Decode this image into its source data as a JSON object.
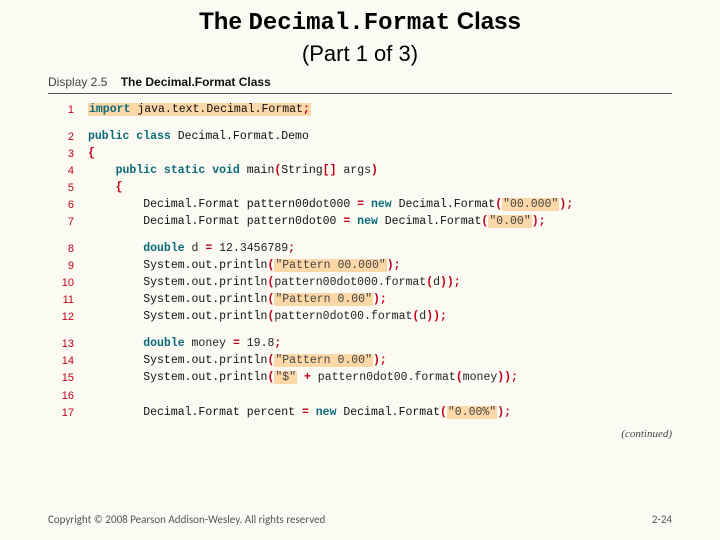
{
  "title_pre": "The ",
  "title_class": "Decimal.Format",
  "title_post": " Class",
  "subtitle": "(Part 1 of 3)",
  "display_label": "Display 2.5",
  "display_caption": "The Decimal.Format Class",
  "lines": [
    {
      "n": "1",
      "indent": 0,
      "tokens": [
        [
          "kw",
          "import "
        ],
        [
          "cls",
          "java.text.Decimal.Format"
        ],
        [
          "op",
          ";"
        ]
      ],
      "hl": true
    },
    {
      "gap": true
    },
    {
      "n": "2",
      "indent": 0,
      "tokens": [
        [
          "kw",
          "public class "
        ],
        [
          "cls",
          "Decimal.Format.Demo"
        ]
      ]
    },
    {
      "n": "3",
      "indent": 0,
      "tokens": [
        [
          "op",
          "{"
        ]
      ]
    },
    {
      "n": "4",
      "indent": 1,
      "tokens": [
        [
          "kw",
          "public static void "
        ],
        [
          "cls",
          "main"
        ],
        [
          "op",
          "("
        ],
        [
          "cls",
          "String"
        ],
        [
          "op",
          "[] "
        ],
        [
          "t",
          "args"
        ],
        [
          "op",
          ")"
        ]
      ]
    },
    {
      "n": "5",
      "indent": 1,
      "tokens": [
        [
          "op",
          "{"
        ]
      ]
    },
    {
      "n": "6",
      "indent": 2,
      "tokens": [
        [
          "cls",
          "Decimal.Format pattern00dot000 "
        ],
        [
          "op",
          "= "
        ],
        [
          "kw",
          "new "
        ],
        [
          "cls",
          "Decimal.Format"
        ],
        [
          "op",
          "("
        ],
        [
          "str",
          "\"00.000\""
        ],
        [
          "op",
          ");"
        ]
      ]
    },
    {
      "n": "7",
      "indent": 2,
      "tokens": [
        [
          "cls",
          "Decimal.Format pattern0dot00 "
        ],
        [
          "op",
          "= "
        ],
        [
          "kw",
          "new "
        ],
        [
          "cls",
          "Decimal.Format"
        ],
        [
          "op",
          "("
        ],
        [
          "str",
          "\"0.00\""
        ],
        [
          "op",
          ");"
        ]
      ]
    },
    {
      "gap": true
    },
    {
      "n": "8",
      "indent": 2,
      "tokens": [
        [
          "kw",
          "double "
        ],
        [
          "t",
          "d "
        ],
        [
          "op",
          "= "
        ],
        [
          "t",
          "12.3456789"
        ],
        [
          "op",
          ";"
        ]
      ]
    },
    {
      "n": "9",
      "indent": 2,
      "tokens": [
        [
          "cls",
          "System.out.println"
        ],
        [
          "op",
          "("
        ],
        [
          "str",
          "\"Pattern 00.000\""
        ],
        [
          "op",
          ");"
        ]
      ]
    },
    {
      "n": "10",
      "indent": 2,
      "tokens": [
        [
          "cls",
          "System.out.println"
        ],
        [
          "op",
          "("
        ],
        [
          "t",
          "pattern00dot000.format"
        ],
        [
          "op",
          "("
        ],
        [
          "t",
          "d"
        ],
        [
          "op",
          "));"
        ]
      ]
    },
    {
      "n": "11",
      "indent": 2,
      "tokens": [
        [
          "cls",
          "System.out.println"
        ],
        [
          "op",
          "("
        ],
        [
          "str",
          "\"Pattern 0.00\""
        ],
        [
          "op",
          ");"
        ]
      ]
    },
    {
      "n": "12",
      "indent": 2,
      "tokens": [
        [
          "cls",
          "System.out.println"
        ],
        [
          "op",
          "("
        ],
        [
          "t",
          "pattern0dot00.format"
        ],
        [
          "op",
          "("
        ],
        [
          "t",
          "d"
        ],
        [
          "op",
          "));"
        ]
      ]
    },
    {
      "gap": true
    },
    {
      "n": "13",
      "indent": 2,
      "tokens": [
        [
          "kw",
          "double "
        ],
        [
          "t",
          "money "
        ],
        [
          "op",
          "= "
        ],
        [
          "t",
          "19.8"
        ],
        [
          "op",
          ";"
        ]
      ]
    },
    {
      "n": "14",
      "indent": 2,
      "tokens": [
        [
          "cls",
          "System.out.println"
        ],
        [
          "op",
          "("
        ],
        [
          "str",
          "\"Pattern 0.00\""
        ],
        [
          "op",
          ");"
        ]
      ]
    },
    {
      "n": "15",
      "indent": 2,
      "tokens": [
        [
          "cls",
          "System.out.println"
        ],
        [
          "op",
          "("
        ],
        [
          "str",
          "\"$\""
        ],
        [
          "op",
          " + "
        ],
        [
          "t",
          "pattern0dot00.format"
        ],
        [
          "op",
          "("
        ],
        [
          "t",
          "money"
        ],
        [
          "op",
          "));"
        ]
      ]
    },
    {
      "n": "16",
      "indent": 2,
      "tokens": []
    },
    {
      "n": "17",
      "indent": 2,
      "tokens": [
        [
          "cls",
          "Decimal.Format percent "
        ],
        [
          "op",
          "= "
        ],
        [
          "kw",
          "new "
        ],
        [
          "cls",
          "Decimal.Format"
        ],
        [
          "op",
          "("
        ],
        [
          "str",
          "\"0.00%\""
        ],
        [
          "op",
          ");"
        ]
      ]
    }
  ],
  "continued": "(continued)",
  "copyright": "Copyright © 2008 Pearson Addison-Wesley. All rights reserved",
  "page_num": "2-24"
}
